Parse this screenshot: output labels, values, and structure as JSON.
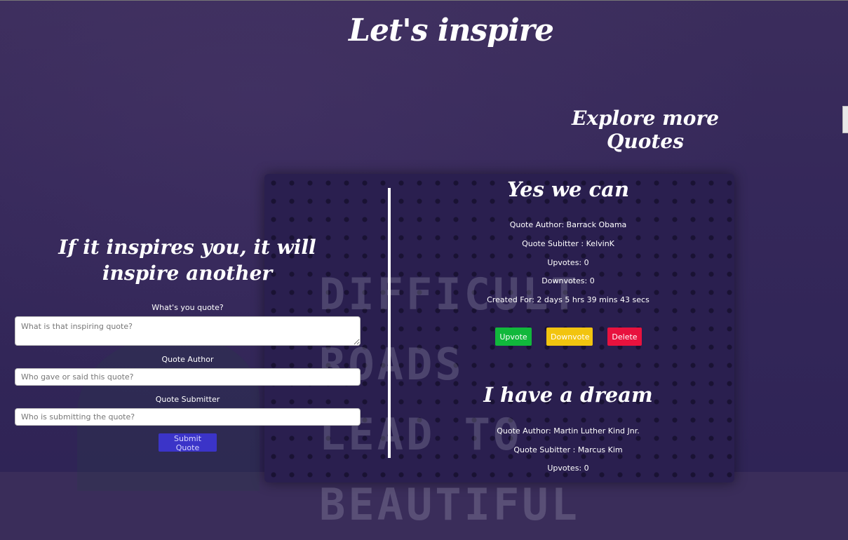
{
  "site": {
    "title": "Let's inspire"
  },
  "background": {
    "board_lines": [
      "DIFFICULT",
      "ROADS",
      "LEAD TO",
      "BEAUTIFUL"
    ]
  },
  "explore": {
    "heading": "Explore more Quotes"
  },
  "form": {
    "heading": "If it inspires you, it will inspire another",
    "quote_label": "What's you quote?",
    "quote_placeholder": "What is that inspiring quote?",
    "author_label": "Quote Author",
    "author_placeholder": "Who gave or said this quote?",
    "submitter_label": "Quote Submitter",
    "submitter_placeholder": "Who is submitting the quote?",
    "submit_label": "Submit Quote"
  },
  "quotes": [
    {
      "title": "Yes we can",
      "author_line": "Quote Author: Barrack Obama",
      "submitter_line": "Quote Subitter : KelvinK",
      "upvotes_line": "Upvotes: 0",
      "downvotes_line": "Downvotes: 0",
      "created_line": "Created For: 2 days 5 hrs 39 mins 43 secs",
      "upvote_label": "Upvote",
      "downvote_label": "Downvote",
      "delete_label": "Delete"
    },
    {
      "title": "I have a dream",
      "author_line": "Quote Author: Martin Luther Kind Jnr.",
      "submitter_line": "Quote Subitter : Marcus Kim",
      "upvotes_line": "Upvotes: 0"
    }
  ],
  "colors": {
    "background": "#3a2d5a",
    "submit": "#3b34c8",
    "upvote": "#11b83c",
    "downvote": "#f2c40f",
    "delete": "#e8123e"
  }
}
